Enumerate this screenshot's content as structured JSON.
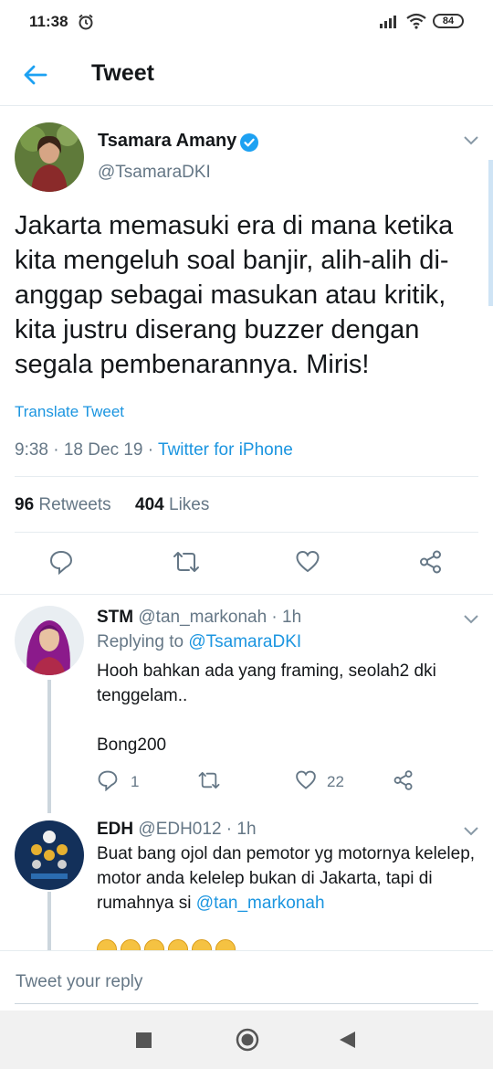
{
  "status_bar": {
    "time": "11:38",
    "battery": "84"
  },
  "header": {
    "title": "Tweet",
    "back_icon": "arrow-left-icon"
  },
  "tweet": {
    "author_name": "Tsamara Amany",
    "author_handle": "@TsamaraDKI",
    "verified": true,
    "text": "Jakarta memasuki era di mana ketika kita mengeluh soal banjir, alih-alih di-anggap sebagai masukan atau kritik, kita justru diserang buzzer dengan segala pembenarannya. Miris!",
    "translate_label": "Translate Tweet",
    "time_date": "9:38 · 18 Dec 19 · ",
    "source": "Twitter for iPhone",
    "retweets_count": "96",
    "retweets_label": "Retweets",
    "likes_count": "404",
    "likes_label": "Likes"
  },
  "replies": [
    {
      "name": "STM",
      "handle_time": "@tan_markonah · 1h",
      "replying_prefix": "Replying to ",
      "replying_to": "@TsamaraDKI",
      "text_line1": "Hooh bahkan ada yang framing, seolah2 dki tenggelam..",
      "text_line2": "Bong200",
      "reply_count": "1",
      "retweet_count": "",
      "like_count": "22"
    },
    {
      "name": "EDH",
      "handle_time": "@EDH012 · 1h",
      "text": "Buat bang ojol dan pemotor yg motornya kelelep, motor anda kelelep bukan di Jakarta, tapi di rumahnya si ",
      "mention": "@tan_markonah"
    }
  ],
  "compose": {
    "placeholder": "Tweet your reply"
  },
  "colors": {
    "accent": "#1b95e0",
    "secondary_text": "#657786",
    "divider": "#e6ecf0"
  }
}
